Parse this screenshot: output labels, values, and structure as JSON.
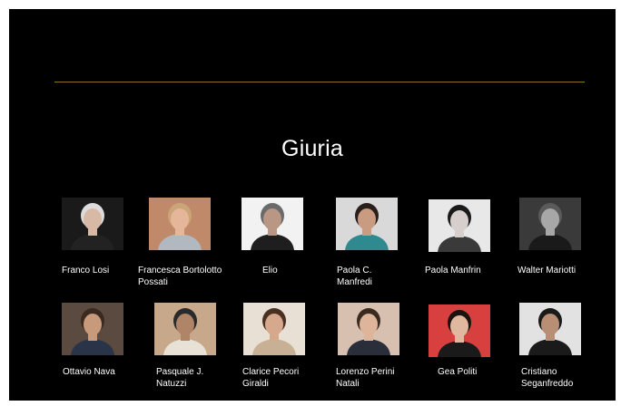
{
  "slide": {
    "title": "Giuria",
    "rule_color": "#8a7424"
  },
  "jury": [
    {
      "name": "Franco Losi",
      "bg": "#1a1a1a",
      "skin": "#d8b9a6",
      "hair": "#dcdcdc",
      "shirt": "#222222"
    },
    {
      "name": "Francesca Bortolotto\nPossati",
      "bg": "#c08a6a",
      "skin": "#e6b69a",
      "hair": "#caa577",
      "shirt": "#b2b8c0"
    },
    {
      "name": "Elio",
      "bg": "#f2f2f2",
      "skin": "#b99784",
      "hair": "#6a6a6a",
      "shirt": "#1e1e1e"
    },
    {
      "name": "Paola C.\nManfredi",
      "bg": "#d9d9d9",
      "skin": "#c99b80",
      "hair": "#2a1f1a",
      "shirt": "#2e8a8f"
    },
    {
      "name": "Paola Manfrin",
      "bg": "#e8e8e8",
      "skin": "#d6cfcb",
      "hair": "#1a1a1a",
      "shirt": "#3a3a3a"
    },
    {
      "name": "Walter Mariotti",
      "bg": "#3a3a3a",
      "skin": "#a7a7a7",
      "hair": "#5a5a5a",
      "shirt": "#1a1a1a"
    },
    {
      "name": "Ottavio Nava",
      "bg": "#5a4a40",
      "skin": "#c89a7c",
      "hair": "#3a2a20",
      "shirt": "#2a3448"
    },
    {
      "name": "Pasquale J.\nNatuzzi",
      "bg": "#c8a88a",
      "skin": "#b08466",
      "hair": "#2a2a2a",
      "shirt": "#e8e2d6"
    },
    {
      "name": "Clarice Pecori\nGiraldi",
      "bg": "#e8e0d4",
      "skin": "#d6a88c",
      "hair": "#4a3020",
      "shirt": "#c8b094"
    },
    {
      "name": "Lorenzo Perini\nNatali",
      "bg": "#d8c0b0",
      "skin": "#deb49a",
      "hair": "#3a2a20",
      "shirt": "#2a2e3a"
    },
    {
      "name": "Gea Politi",
      "bg": "#d84040",
      "skin": "#e0b8a0",
      "hair": "#1a1410",
      "shirt": "#1a1a1a"
    },
    {
      "name": "Cristiano\nSeganfreddo",
      "bg": "#e2e2e2",
      "skin": "#b88e74",
      "hair": "#1a1a1a",
      "shirt": "#1a1a1a"
    }
  ]
}
